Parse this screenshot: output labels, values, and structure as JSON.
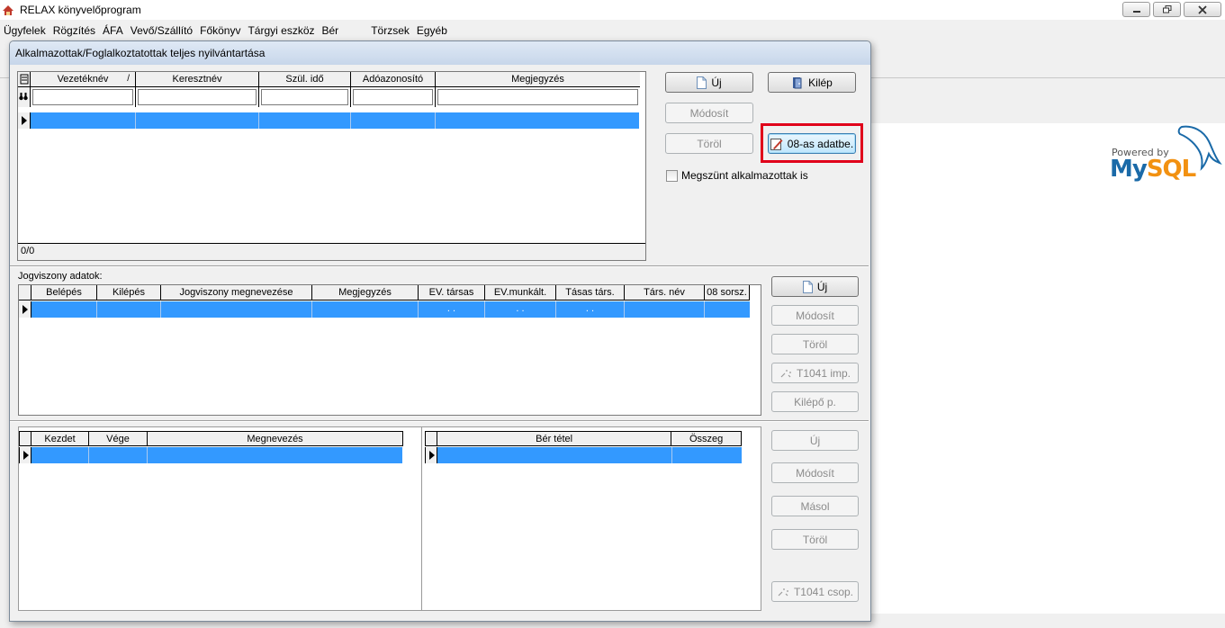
{
  "app": {
    "title": "RELAX könyvelőprogram",
    "menu": [
      "Ügyfelek",
      "Rögzítés",
      "ÁFA",
      "Vevő/Szállító",
      "Főkönyv",
      "Tárgyi eszköz",
      "Bér",
      "Törzsek",
      "Egyéb"
    ]
  },
  "dialog": {
    "title": "Alkalmazottak/Foglalkoztatottak teljes nyilvántartása",
    "employees": {
      "columns": [
        "Vezetéknév",
        "Keresztnév",
        "Szül. idő",
        "Adóazonosító",
        "Megjegyzés"
      ],
      "sort_mark": "/",
      "filters": [
        "",
        "",
        "",
        "",
        ""
      ],
      "footer": "0/0"
    },
    "buttons_top": {
      "new": "Új",
      "exit": "Kilép",
      "modify": "Módosít",
      "delete": "Töröl",
      "data08": "08-as adatbe."
    },
    "checkbox_label": "Megszünt alkalmazottak is",
    "legal": {
      "label": "Jogviszony adatok:",
      "columns": [
        "Belépés",
        "Kilépés",
        "Jogviszony megnevezése",
        "Megjegyzés",
        "EV. társas",
        "EV.munkált.",
        "Tásas társ.",
        "Társ. név",
        "08 sorsz."
      ],
      "row_dots": ". .",
      "buttons": {
        "new": "Új",
        "modify": "Módosít",
        "delete": "Töröl",
        "t1041imp": "T1041 imp.",
        "exitsheet": "Kilépő p."
      }
    },
    "periods": {
      "columns": [
        "Kezdet",
        "Vége",
        "Megnevezés"
      ]
    },
    "wage": {
      "columns": [
        "Bér tétel",
        "Összeg"
      ]
    },
    "buttons_bottom": {
      "new": "Új",
      "modify": "Módosít",
      "copy": "Másol",
      "delete": "Töröl",
      "t1041group": "T1041 csop."
    }
  },
  "logo": {
    "powered": "Powered by",
    "my": "My",
    "sql": "SQL"
  }
}
